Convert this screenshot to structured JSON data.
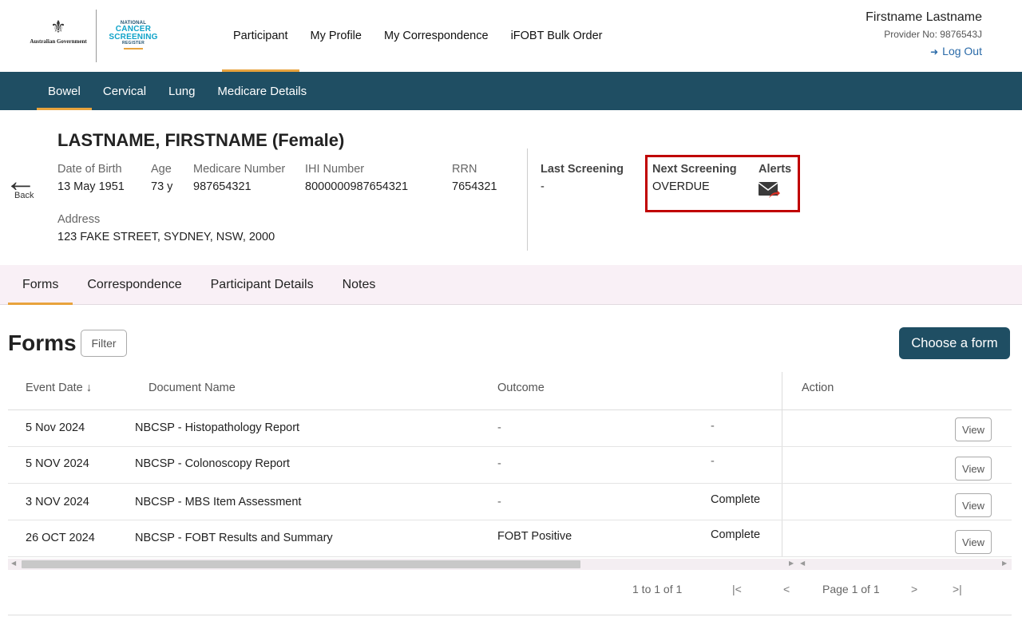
{
  "header": {
    "gov_logo_text": "Australian Government",
    "ncsr_logo": [
      "NATIONAL",
      "CANCER",
      "SCREENING",
      "REGISTER"
    ],
    "nav": [
      "Participant",
      "My Profile",
      "My Correspondence",
      "iFOBT Bulk Order"
    ],
    "active_nav": "Participant",
    "user_name": "Firstname Lastname",
    "provider_no": "Provider No: 9876543J",
    "logout_label": "Log Out"
  },
  "subnav": {
    "items": [
      "Bowel",
      "Cervical",
      "Lung",
      "Medicare Details"
    ],
    "active": "Bowel"
  },
  "participant": {
    "back_label": "Back",
    "name": "LASTNAME, FIRSTNAME (Female)",
    "dob_label": "Date of Birth",
    "dob": "13 May 1951",
    "age_label": "Age",
    "age": "73 y",
    "medicare_label": "Medicare Number",
    "medicare": "987654321",
    "ihi_label": "IHI Number",
    "ihi": "8000000987654321",
    "rrn_label": "RRN",
    "rrn": "7654321",
    "address_label": "Address",
    "address": "123 FAKE STREET, SYDNEY, NSW, 2000",
    "last_screening_label": "Last Screening",
    "last_screening": "-",
    "next_screening_label": "Next Screening",
    "next_screening": "OVERDUE",
    "alerts_label": "Alerts",
    "alerts_icon": "mail-alert-icon",
    "highlight_color": "#c00000"
  },
  "tabs": {
    "items": [
      "Forms",
      "Correspondence",
      "Participant Details",
      "Notes"
    ],
    "active": "Forms"
  },
  "forms": {
    "title": "Forms",
    "filter_label": "Filter",
    "choose_label": "Choose a form",
    "columns": {
      "event_date": "Event Date ↓",
      "document_name": "Document Name",
      "outcome": "Outcome",
      "action": "Action"
    },
    "rows": [
      {
        "date": "5 Nov 2024",
        "doc": "NBCSP - Histopathology Report",
        "outcome": "-",
        "status": "-",
        "action": "View"
      },
      {
        "date": "5 NOV 2024",
        "doc": "NBCSP - Colonoscopy Report",
        "outcome": "-",
        "status": "-",
        "action": "View"
      },
      {
        "date": "3 NOV 2024",
        "doc": "NBCSP - MBS Item Assessment",
        "outcome": "-",
        "status": "Complete",
        "action": "View"
      },
      {
        "date": "26 OCT 2024",
        "doc": "NBCSP - FOBT Results and Summary",
        "outcome": "FOBT Positive",
        "status": "Complete",
        "action": "View"
      }
    ]
  },
  "pagination": {
    "summary": "1 to 1 of 1",
    "first": "|<",
    "prev": "<",
    "page_label": "Page 1 of 1",
    "next": ">",
    "last": ">|"
  },
  "colors": {
    "brand_teal": "#1f4e63",
    "accent_orange": "#e8a33d",
    "tab_bar_bg": "#f9f0f6",
    "link_blue": "#2a6aa8"
  }
}
